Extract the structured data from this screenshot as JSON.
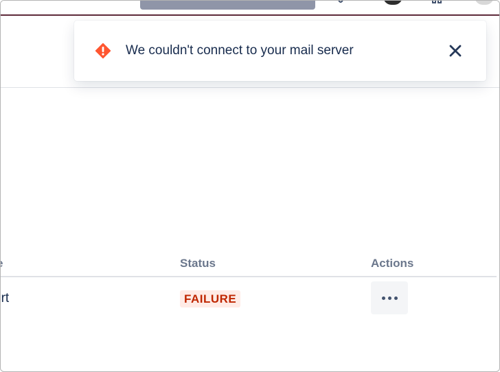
{
  "toast": {
    "icon": "error-icon",
    "message": "We couldn't connect to your mail server",
    "close_icon": "close-icon",
    "colors": {
      "error": "#ff5630",
      "text": "#172b4d"
    }
  },
  "table": {
    "columns": {
      "name": "e",
      "status": "Status",
      "actions": "Actions"
    },
    "rows": [
      {
        "name": "ort",
        "status": "FAILURE",
        "actions_icon": "more-horizontal-icon"
      }
    ],
    "colors": {
      "status_failure_text": "#bf2600",
      "status_failure_bg": "#ffebe6"
    }
  },
  "nav": {
    "icons": [
      "help-icon",
      "profile-icon",
      "settings-icon",
      "avatar"
    ],
    "accent": "#5e2a3a"
  }
}
